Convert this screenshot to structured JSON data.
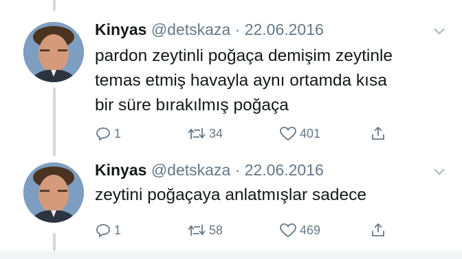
{
  "tweets": [
    {
      "author_name": "Kinyas",
      "handle": "@detskaza",
      "separator": "·",
      "date": "22.06.2016",
      "text_lines": [
        "pardon zeytinli poğaça demişim zeytinle",
        "temas etmiş havayla aynı ortamda kısa",
        "bir süre bırakılmış poğaça"
      ],
      "reply_count": "1",
      "retweet_count": "34",
      "like_count": "401"
    },
    {
      "author_name": "Kinyas",
      "handle": "@detskaza",
      "separator": "·",
      "date": "22.06.2016",
      "text_lines": [
        "zeytini poğaçaya anlatmışlar sadece"
      ],
      "reply_count": "1",
      "retweet_count": "58",
      "like_count": "469"
    }
  ],
  "icons": {
    "reply": "reply-icon",
    "retweet": "retweet-icon",
    "like": "heart-icon",
    "share": "share-icon",
    "menu": "chevron-down-icon"
  },
  "colors": {
    "text_primary": "#14171a",
    "text_secondary": "#657786",
    "thread_line": "#cfd9de"
  }
}
